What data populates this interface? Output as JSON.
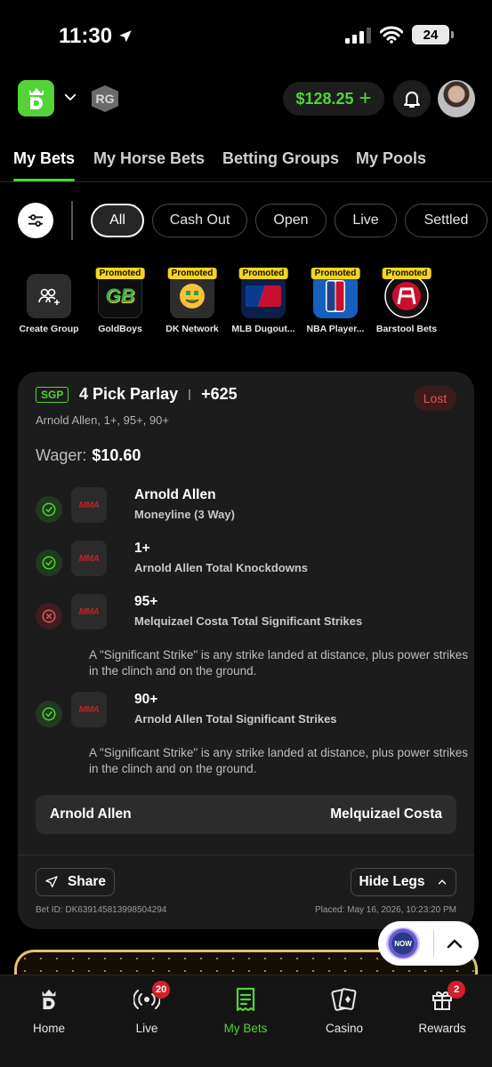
{
  "status_bar": {
    "time": "11:30",
    "battery": "24"
  },
  "header": {
    "logo": "DK",
    "rg_badge": "RG",
    "balance": "$128.25",
    "balance_add": "+"
  },
  "tabs": [
    {
      "label": "My Bets",
      "active": true
    },
    {
      "label": "My Horse Bets",
      "active": false
    },
    {
      "label": "Betting Groups",
      "active": false
    },
    {
      "label": "My Pools",
      "active": false
    }
  ],
  "filters": {
    "chips": [
      {
        "label": "All",
        "active": true
      },
      {
        "label": "Cash Out",
        "active": false
      },
      {
        "label": "Open",
        "active": false
      },
      {
        "label": "Live",
        "active": false
      },
      {
        "label": "Settled",
        "active": false
      }
    ]
  },
  "groups": {
    "promo_label": "Promoted",
    "items": [
      {
        "label": "Create Group",
        "promoted": false,
        "icon": "users-plus-icon"
      },
      {
        "label": "GoldBoys",
        "promoted": true,
        "icon": "goldboys-logo",
        "logo_text": "GB"
      },
      {
        "label": "DK Network",
        "promoted": true,
        "icon": "money-face-icon"
      },
      {
        "label": "MLB Dugout...",
        "promoted": true,
        "icon": "mlb-logo"
      },
      {
        "label": "NBA Player...",
        "promoted": true,
        "icon": "nba-logo"
      },
      {
        "label": "Barstool Bets",
        "promoted": true,
        "icon": "barstool-logo"
      }
    ]
  },
  "bet": {
    "type_badge": "SGP",
    "title": "4 Pick Parlay",
    "odds": "+625",
    "result": "Lost",
    "summary": "Arnold Allen, 1+, 95+, 90+",
    "wager_label": "Wager:",
    "wager_value": "$10.60",
    "sport_icon_text": "MMA",
    "legs": [
      {
        "status": "win",
        "title": "Arnold Allen",
        "market": "Moneyline (3 Way)",
        "note": ""
      },
      {
        "status": "win",
        "title": "1+",
        "market": "Arnold Allen Total Knockdowns",
        "note": ""
      },
      {
        "status": "loss",
        "title": "95+",
        "market": "Melquizael Costa Total Significant Strikes",
        "note": "A \"Significant Strike\" is any strike landed at distance, plus power strikes in the clinch and on the ground."
      },
      {
        "status": "win",
        "title": "90+",
        "market": "Arnold Allen Total Significant Strikes",
        "note": "A \"Significant Strike\" is any strike landed at distance, plus power strikes in the clinch and on the ground."
      }
    ],
    "matchup": {
      "left": "Arnold Allen",
      "right": "Melquizael Costa"
    },
    "share_label": "Share",
    "hide_legs_label": "Hide Legs",
    "bet_id": "Bet ID: DK639145813998504294",
    "placed": "Placed: May 16, 2026, 10:23:20 PM"
  },
  "floating": {
    "blackjack_now": "NOW"
  },
  "bottom_nav": [
    {
      "label": "Home",
      "badge": "",
      "active": false
    },
    {
      "label": "Live",
      "badge": "20",
      "active": false
    },
    {
      "label": "My Bets",
      "badge": "",
      "active": true
    },
    {
      "label": "Casino",
      "badge": "",
      "active": false
    },
    {
      "label": "Rewards",
      "badge": "2",
      "active": false
    }
  ],
  "colors": {
    "accent": "#53d337",
    "loss": "#e05757",
    "promo": "#f5d51f"
  }
}
